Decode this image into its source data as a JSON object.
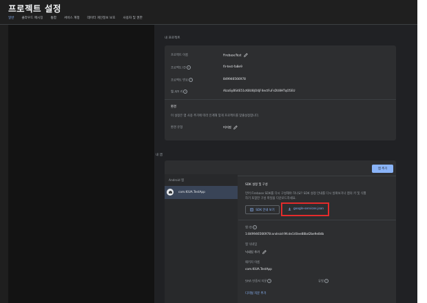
{
  "page_title": "프로젝트 설정",
  "tabs": [
    {
      "label": "일반",
      "active": true
    },
    {
      "label": "클라우드 메시징",
      "active": false
    },
    {
      "label": "통합",
      "active": false
    },
    {
      "label": "서비스 계정",
      "active": false
    },
    {
      "label": "데이터 개인정보 보호",
      "active": false
    },
    {
      "label": "사용자 및 권한",
      "active": false
    }
  ],
  "project_section": {
    "heading": "내 프로젝트",
    "rows": [
      {
        "key": "프로젝트 이름",
        "value": "FirebaseTest",
        "editable": true,
        "info": false
      },
      {
        "key": "프로젝트 ID",
        "value": "fir-test-fa8e9",
        "editable": false,
        "info": true
      },
      {
        "key": "프로젝트 번호",
        "value": "849946566978",
        "editable": false,
        "info": true
      },
      {
        "key": "웹 API 키",
        "value": "AIzaSyBS4E51cK8U8jO4jF4ectFuFsDU8HTqO5EU",
        "editable": false,
        "info": true
      }
    ],
    "env_heading": "환경",
    "env_desc": "이 설정은 앱 사용 추가에 따라 인계해 맞게 프로젝트를 맞출설정합니다.",
    "env_key": "환경 유형",
    "env_value": "미지정"
  },
  "apps_section": {
    "heading": "내 앱",
    "add_app_label": "앱 추가",
    "list_header": "Android 앱",
    "app_name": "com.KIUA.TestApp",
    "sdk_heading": "SDK 설정 및 구성",
    "sdk_desc_1": "언어 Firebase SDK를 다시 구성해야 하나요? SDK 설정 안내를 다시 살펴보거나 앱의 키 및 식별",
    "sdk_desc_2": "하기 포함한 구성 파일을 다운로드하세요.",
    "sdk_guide_button": "SDK 안내 보기",
    "download_button": "google-services.json",
    "app_id_key": "앱 ID",
    "app_id_value": "1:849946566978:android:9fcde140ee88bd2be9e8db",
    "nickname_key": "앱 닉네임",
    "nickname_value": "닉네임 추가",
    "package_key": "패키지 이름",
    "package_value": "com.KIUA.TestApp",
    "sha_key": "SHA 인증서 지문",
    "type_key": "유형",
    "add_fingerprint_link": "디지털 지문 추가"
  },
  "colors": {
    "accent": "#8ab4f8",
    "highlight_box": "#e52b2b",
    "background": "#1f1f1f",
    "card": "#2d2e30"
  }
}
